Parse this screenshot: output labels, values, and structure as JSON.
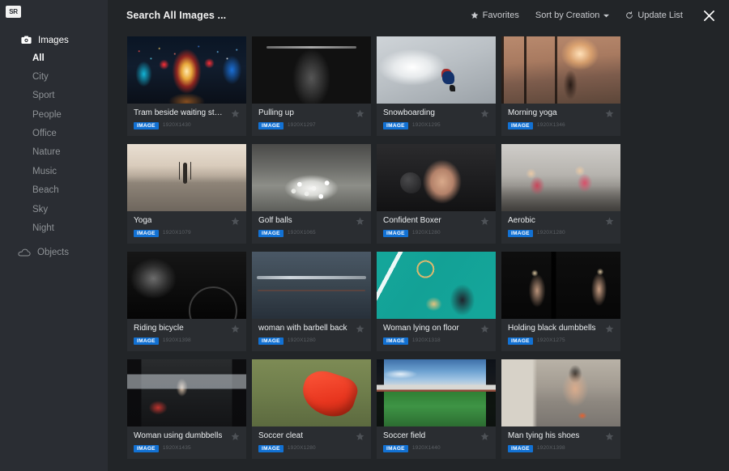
{
  "app": {
    "logo_text": "SR"
  },
  "sidebar": {
    "section": {
      "label": "Images",
      "icon": "camera-icon"
    },
    "items": [
      {
        "label": "All",
        "active": true
      },
      {
        "label": "City",
        "active": false
      },
      {
        "label": "Sport",
        "active": false
      },
      {
        "label": "People",
        "active": false
      },
      {
        "label": "Office",
        "active": false
      },
      {
        "label": "Nature",
        "active": false
      },
      {
        "label": "Music",
        "active": false
      },
      {
        "label": "Beach",
        "active": false
      },
      {
        "label": "Sky",
        "active": false
      },
      {
        "label": "Night",
        "active": false
      }
    ],
    "footer": {
      "label": "Objects",
      "icon": "cloud-icon"
    }
  },
  "topbar": {
    "title": "Search All Images ...",
    "favorites_label": "Favorites",
    "sort_label": "Sort by Creation",
    "update_label": "Update List",
    "close_label": "Close"
  },
  "colors": {
    "accent_badge": "#1271d3",
    "sidebar_bg": "#2a2d33",
    "main_bg": "#222528",
    "card_bg": "#2a2d31",
    "text_primary": "#eceff1",
    "text_muted": "#8e9296",
    "resolution_text": "#5c6065"
  },
  "grid": {
    "badge_label": "IMAGE",
    "cards": [
      {
        "title": "Tram beside waiting station",
        "resolution": "1920X1430",
        "art": "art-tram",
        "favorite": false
      },
      {
        "title": "Pulling up",
        "resolution": "1920X1297",
        "art": "art-pullup",
        "favorite": false
      },
      {
        "title": "Snowboarding",
        "resolution": "1920X1295",
        "art": "art-snow",
        "favorite": false
      },
      {
        "title": "Morning yoga",
        "resolution": "1920X1346",
        "art": "art-yoga1",
        "favorite": false
      },
      {
        "title": "Yoga",
        "resolution": "1920X1079",
        "art": "art-yoga2",
        "favorite": false
      },
      {
        "title": "Golf balls",
        "resolution": "1920X1065",
        "art": "art-golf",
        "favorite": false
      },
      {
        "title": "Confident Boxer",
        "resolution": "1920X1280",
        "art": "art-boxer",
        "favorite": false
      },
      {
        "title": "Aerobic",
        "resolution": "1920X1280",
        "art": "art-aerobic",
        "favorite": false
      },
      {
        "title": "Riding bicycle",
        "resolution": "1920X1398",
        "art": "art-bicycle",
        "favorite": false
      },
      {
        "title": "woman with barbell back",
        "resolution": "1920X1280",
        "art": "art-barbell",
        "favorite": false
      },
      {
        "title": "Woman lying on floor",
        "resolution": "1920X1318",
        "art": "art-tennis",
        "favorite": false
      },
      {
        "title": "Holding black dumbbells",
        "resolution": "1920X1275",
        "art": "art-dumbbells",
        "favorite": false
      },
      {
        "title": "Woman using dumbbells",
        "resolution": "1920X1435",
        "art": "art-gym",
        "favorite": false
      },
      {
        "title": "Soccer cleat",
        "resolution": "1920X1280",
        "art": "art-cleat",
        "favorite": false
      },
      {
        "title": "Soccer field",
        "resolution": "1920X1440",
        "art": "art-field",
        "favorite": false
      },
      {
        "title": "Man tying his shoes",
        "resolution": "1920X1398",
        "art": "art-shoes",
        "favorite": false
      }
    ]
  }
}
